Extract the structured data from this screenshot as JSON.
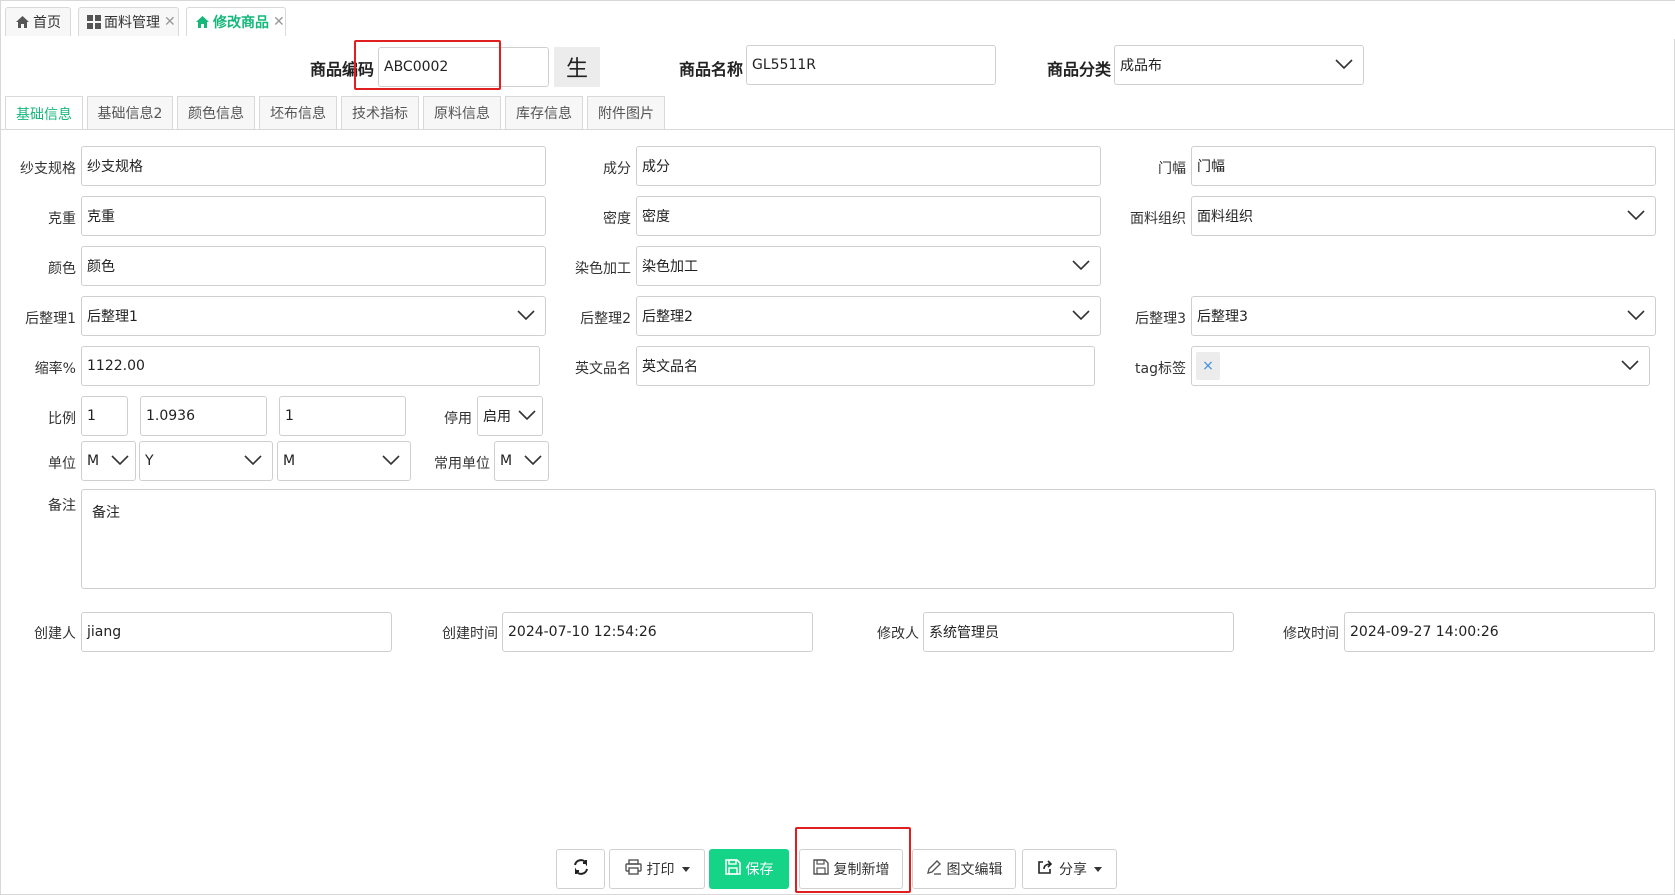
{
  "tabs": [
    {
      "label": "首页",
      "icon": "home-icon"
    },
    {
      "label": "面料管理",
      "icon": "grid-icon"
    },
    {
      "label": "修改商品",
      "icon": "home-icon"
    }
  ],
  "header": {
    "code_label": "商品编码",
    "code_value": "ABC0002",
    "gen_label": "生",
    "name_label": "商品名称",
    "name_value": "GL5511R",
    "category_label": "商品分类",
    "category_value": "成品布"
  },
  "subtabs": [
    "基础信息",
    "基础信息2",
    "颜色信息",
    "坯布信息",
    "技术指标",
    "原料信息",
    "库存信息",
    "附件图片"
  ],
  "form": {
    "yarn_label": "纱支规格",
    "yarn_value": "纱支规格",
    "comp_label": "成分",
    "comp_value": "成分",
    "width_label": "门幅",
    "width_value": "门幅",
    "weight_label": "克重",
    "weight_value": "克重",
    "density_label": "密度",
    "density_value": "密度",
    "weave_label": "面料组织",
    "weave_value": "面料组织",
    "color_label": "颜色",
    "color_value": "颜色",
    "dye_label": "染色加工",
    "dye_value": "染色加工",
    "post1_label": "后整理1",
    "post1_value": "后整理1",
    "post2_label": "后整理2",
    "post2_value": "后整理2",
    "post3_label": "后整理3",
    "post3_value": "后整理3",
    "shrink_label": "缩率%",
    "shrink_value": "1122.00",
    "en_label": "英文品名",
    "en_value": "英文品名",
    "tag_label": "tag标签",
    "tag_chip": "×",
    "ratio_label": "比例",
    "ratio1": "1",
    "ratio2": "1.0936",
    "ratio3": "1",
    "disable_label": "停用",
    "disable_value": "启用",
    "unit_label": "单位",
    "unit1": "M",
    "unit2": "Y",
    "unit3": "M",
    "common_unit_label": "常用单位",
    "common_unit_value": "M",
    "remark_label": "备注",
    "remark_value": "备注",
    "creator_label": "创建人",
    "creator_value": "jiang",
    "ctime_label": "创建时间",
    "ctime_value": "2024-07-10 12:54:26",
    "modifier_label": "修改人",
    "modifier_value": "系统管理员",
    "mtime_label": "修改时间",
    "mtime_value": "2024-09-27 14:00:26"
  },
  "buttons": {
    "print": "打印",
    "save": "保存",
    "copy_new": "复制新增",
    "edit_rich": "图文编辑",
    "share": "分享"
  },
  "colors": {
    "accent": "#16b77a",
    "save_bg": "#16d487",
    "highlight": "#e02020"
  }
}
